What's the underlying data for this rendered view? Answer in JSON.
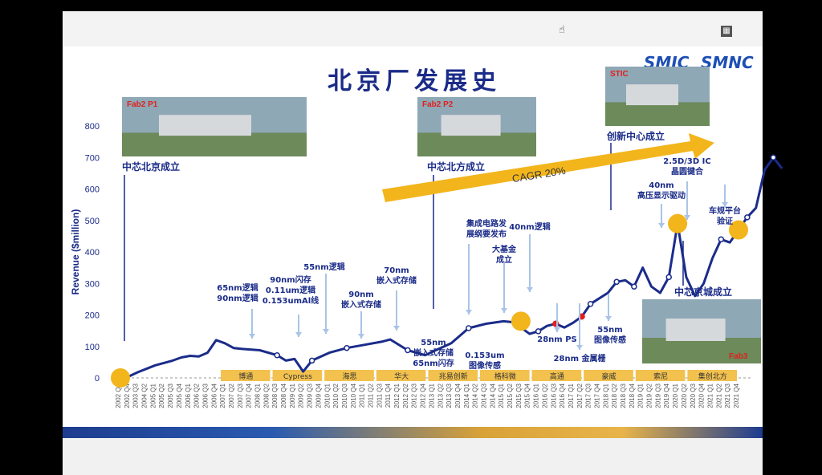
{
  "slide": {
    "title": "北京厂发展史",
    "logos": [
      "SMIC",
      "SMNC"
    ]
  },
  "chart_data": {
    "type": "line",
    "ylabel": "Revenue ($million)",
    "ylim": [
      0,
      800
    ],
    "yticks": [
      0,
      100,
      200,
      300,
      400,
      500,
      600,
      700,
      800
    ],
    "categories": [
      "2002 Q1",
      "2002 Q4",
      "2003 Q3",
      "2004 Q2",
      "2005 Q1",
      "2005 Q4",
      "2006 Q3",
      "2007 Q2",
      "2008 Q1",
      "2008 Q4",
      "2009 Q3",
      "2010 Q2",
      "2011 Q1",
      "2011 Q4",
      "2012 Q3",
      "2013 Q2",
      "2014 Q1",
      "2014 Q4",
      "2015 Q3",
      "2016 Q2",
      "2017 Q1",
      "2017 Q4",
      "2018 Q3",
      "2019 Q2",
      "2020 Q1",
      "2020 Q4",
      "2021 Q3",
      "2021 Q4"
    ],
    "x_ticks": [
      "2002 Q1",
      "2002 Q4",
      "2003 Q3",
      "2004 Q2",
      "2005 Q1",
      "2005 Q2",
      "2005 Q3",
      "2005 Q4",
      "2006 Q1",
      "2006 Q2",
      "2006 Q3",
      "2006 Q4",
      "2007 Q1",
      "2007 Q2",
      "2007 Q3",
      "2007 Q4",
      "2008 Q1",
      "2008 Q2",
      "2008 Q3",
      "2008 Q4",
      "2009 Q1",
      "2009 Q2",
      "2009 Q3",
      "2009 Q4",
      "2010 Q1",
      "2010 Q2",
      "2010 Q3",
      "2010 Q4",
      "2011 Q1",
      "2011 Q2",
      "2011 Q3",
      "2011 Q4",
      "2012 Q1",
      "2012 Q2",
      "2012 Q3",
      "2012 Q4",
      "2013 Q1",
      "2013 Q2",
      "2013 Q3",
      "2013 Q4",
      "2014 Q1",
      "2014 Q2",
      "2014 Q3",
      "2014 Q4",
      "2015 Q1",
      "2015 Q2",
      "2015 Q3",
      "2015 Q4",
      "2016 Q1",
      "2016 Q2",
      "2016 Q3",
      "2016 Q4",
      "2017 Q1",
      "2017 Q2",
      "2017 Q3",
      "2017 Q4",
      "2018 Q1",
      "2018 Q2",
      "2018 Q3",
      "2018 Q4",
      "2019 Q1",
      "2019 Q2",
      "2019 Q3",
      "2019 Q4",
      "2020 Q1",
      "2020 Q2",
      "2020 Q3",
      "2020 Q4",
      "2021 Q1",
      "2021 Q2",
      "2021 Q3",
      "2021 Q4"
    ],
    "series": [
      {
        "name": "",
        "points": [
          [
            0,
            0
          ],
          [
            1,
            5
          ],
          [
            2,
            18
          ],
          [
            4,
            40
          ],
          [
            6,
            55
          ],
          [
            7,
            65
          ],
          [
            8,
            70
          ],
          [
            9,
            68
          ],
          [
            10,
            80
          ],
          [
            11,
            120
          ],
          [
            12,
            110
          ],
          [
            13,
            95
          ],
          [
            14,
            92
          ],
          [
            16,
            88
          ],
          [
            18,
            72
          ],
          [
            19,
            55
          ],
          [
            20,
            60
          ],
          [
            21,
            20
          ],
          [
            22,
            55
          ],
          [
            24,
            80
          ],
          [
            26,
            95
          ],
          [
            28,
            105
          ],
          [
            30,
            115
          ],
          [
            31,
            122
          ],
          [
            33,
            88
          ],
          [
            35,
            72
          ],
          [
            36,
            85
          ],
          [
            38,
            110
          ],
          [
            40,
            158
          ],
          [
            42,
            172
          ],
          [
            44,
            180
          ],
          [
            45,
            177
          ],
          [
            46,
            160
          ],
          [
            47,
            140
          ],
          [
            48,
            148
          ],
          [
            49,
            165
          ],
          [
            50,
            172
          ],
          [
            51,
            160
          ],
          [
            52,
            175
          ],
          [
            53,
            195
          ],
          [
            54,
            235
          ],
          [
            56,
            270
          ],
          [
            57,
            305
          ],
          [
            58,
            310
          ],
          [
            59,
            290
          ],
          [
            60,
            350
          ],
          [
            61,
            290
          ],
          [
            62,
            270
          ],
          [
            63,
            320
          ],
          [
            64,
            490
          ],
          [
            65,
            320
          ],
          [
            66,
            260
          ],
          [
            67,
            300
          ],
          [
            68,
            380
          ],
          [
            69,
            440
          ],
          [
            70,
            430
          ],
          [
            71,
            470
          ],
          [
            72,
            510
          ],
          [
            73,
            540
          ],
          [
            74,
            660
          ],
          [
            75,
            700
          ],
          [
            76,
            665
          ]
        ]
      }
    ],
    "events": [
      {
        "x": 0,
        "y": 0,
        "marker": "circle",
        "label": "中芯北京成立",
        "label_style": "big"
      },
      {
        "x": 46,
        "y": 180,
        "marker": "circle",
        "label": "中芯北方成立",
        "label_style": "big"
      },
      {
        "x": 64,
        "y": 490,
        "marker": "circle",
        "label": "创新中心成立",
        "label_style": "big"
      },
      {
        "x": 71,
        "y": 470,
        "marker": "circle",
        "label": "中芯京城成立",
        "label_style": "big"
      }
    ],
    "annotations": [
      {
        "text": "65nm逻辑\n90nm逻辑",
        "x": 17
      },
      {
        "text": "90nm闪存\n0.11um逻辑\n0.153umAl线",
        "x": 23
      },
      {
        "text": "55nm逻辑",
        "x": 27
      },
      {
        "text": "90nm\n嵌入式存储",
        "x": 32
      },
      {
        "text": "70nm\n嵌入式存储",
        "x": 37
      },
      {
        "text": "55nm\n嵌入式存储\n65nm闪存",
        "x": 44
      },
      {
        "text": "集成电路发\n展纲要发布",
        "x": 49
      },
      {
        "text": "大基金\n成立",
        "x": 53
      },
      {
        "text": "0.153um\n图像传感",
        "x": 51
      },
      {
        "text": "40nm逻辑",
        "x": 58
      },
      {
        "text": "28nm PS",
        "x": 60
      },
      {
        "text": "28nm 金属栅",
        "x": 62
      },
      {
        "text": "55nm\n图像传感",
        "x": 65
      },
      {
        "text": "40nm\n高压显示驱动",
        "x": 70
      },
      {
        "text": "2.5D/3D IC\n晶圆键合",
        "x": 73
      },
      {
        "text": "车规平台\n验证",
        "x": 76
      }
    ],
    "red_dots": [
      {
        "x": 50,
        "y": 172
      },
      {
        "x": 53,
        "y": 195
      }
    ],
    "cagr_label": "CAGR 20%",
    "customers": [
      "博通",
      "Cypress",
      "海思",
      "华大",
      "兆易创新",
      "格科微",
      "高通",
      "豪威",
      "索尼",
      "集创北方"
    ],
    "photos": [
      {
        "label": "Fab2 P1",
        "caption": "中芯北京成立"
      },
      {
        "label": "Fab2 P2",
        "caption": "中芯北方成立"
      },
      {
        "label": "STIC",
        "caption": "创新中心成立"
      },
      {
        "label": "Fab3",
        "caption": "中芯京城成立"
      }
    ],
    "colors": {
      "line": "#1b2c8a",
      "marker": "#f2b51c",
      "red_dot": "#e0201e",
      "arrow": "#f2b51c",
      "customer_bar": "#f2c14e",
      "label": "#1a2b88"
    }
  }
}
